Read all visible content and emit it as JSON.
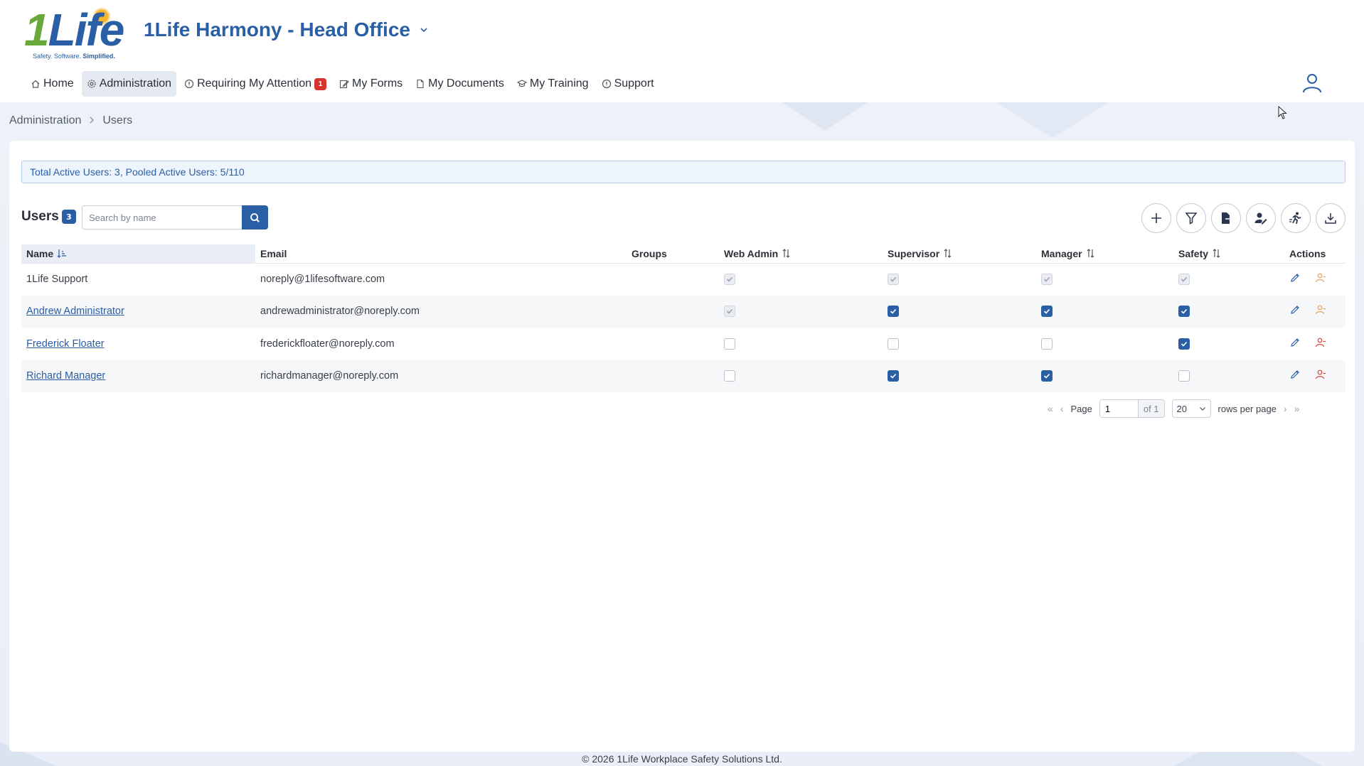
{
  "header": {
    "logo_text": "1Life",
    "logo_tagline": "Safety. Software.",
    "logo_tagline_bold": "Simplified.",
    "org_title": "1Life Harmony - Head Office"
  },
  "nav": {
    "items": [
      {
        "label": "Home",
        "icon": "home-icon"
      },
      {
        "label": "Administration",
        "icon": "gear-icon"
      },
      {
        "label": "Requiring My Attention",
        "icon": "info-icon",
        "badge": "1"
      },
      {
        "label": "My Forms",
        "icon": "edit-icon"
      },
      {
        "label": "My Documents",
        "icon": "document-icon"
      },
      {
        "label": "My Training",
        "icon": "graduation-icon"
      },
      {
        "label": "Support",
        "icon": "info-icon"
      }
    ]
  },
  "breadcrumb": {
    "parent": "Administration",
    "current": "Users"
  },
  "info_bar": "Total Active Users: 3, Pooled Active Users: 5/110",
  "users": {
    "title": "Users",
    "count": "3",
    "search_placeholder": "Search by name",
    "columns": [
      "Name",
      "Email",
      "Groups",
      "Web Admin",
      "Supervisor",
      "Manager",
      "Safety",
      "Actions"
    ],
    "rows": [
      {
        "name": "1Life Support",
        "link": false,
        "email": "noreply@1lifesoftware.com",
        "groups": "",
        "web_admin": "checked-disabled",
        "supervisor": "checked-disabled",
        "manager": "checked-disabled",
        "safety": "checked-disabled"
      },
      {
        "name": "Andrew Administrator",
        "link": true,
        "email": "andrewadministrator@noreply.com",
        "groups": "",
        "web_admin": "checked-disabled",
        "supervisor": "checked",
        "manager": "checked",
        "safety": "checked"
      },
      {
        "name": "Frederick Floater",
        "link": true,
        "email": "frederickfloater@noreply.com",
        "groups": "",
        "web_admin": "unchecked",
        "supervisor": "unchecked",
        "manager": "unchecked",
        "safety": "checked"
      },
      {
        "name": "Richard Manager",
        "link": true,
        "email": "richardmanager@noreply.com",
        "groups": "",
        "web_admin": "unchecked",
        "supervisor": "checked",
        "manager": "checked",
        "safety": "unchecked"
      }
    ]
  },
  "pager": {
    "page_label": "Page",
    "page_value": "1",
    "of_label": "of 1",
    "rows_value": "20",
    "rows_label": "rows per page"
  },
  "footer": "© 2026 1Life Workplace Safety Solutions Ltd.",
  "colors": {
    "brand": "#2a5fa6",
    "accent_green": "#69a83a",
    "badge_red": "#d9342b"
  }
}
